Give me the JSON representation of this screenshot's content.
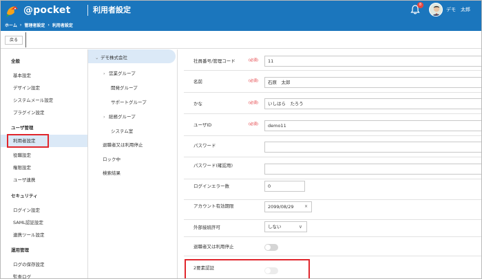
{
  "header": {
    "logo_text": "@pocket",
    "page_title": "利用者設定",
    "notification_count": "8",
    "user_name": "デモ　太郎",
    "breadcrumb": [
      "ホーム",
      "管理者設定",
      "利用者設定"
    ],
    "breadcrumb_separator": "›"
  },
  "toolbar": {
    "back_label": "戻る"
  },
  "leftnav": {
    "sections": [
      {
        "title": "全般",
        "items": [
          "基本設定",
          "デザイン設定",
          "システムメール設定",
          "プラグイン設定"
        ]
      },
      {
        "title": "ユーザ管理",
        "items": [
          "利用者設定",
          "役職設定",
          "権限設定",
          "ユーザ連携"
        ]
      },
      {
        "title": "セキュリティ",
        "items": [
          "ログイン設定",
          "SAML認証設定",
          "連携ツール設定"
        ]
      },
      {
        "title": "運用管理",
        "items": [
          "ログの保存設定",
          "監査ログ"
        ]
      }
    ],
    "active_item": "利用者設定"
  },
  "tree": {
    "root": "デモ株式会社",
    "children": [
      "営業グループ",
      "開発グループ",
      "サポートグループ",
      "総務グループ",
      "システム室"
    ],
    "extra": [
      "退職者又は利用停止",
      "ロック中",
      "検索結果"
    ]
  },
  "form": {
    "required_tag": "(必須)",
    "fields": [
      {
        "label": "社員番号/管理コード",
        "value": "11"
      },
      {
        "label": "名前",
        "value": "石原　太郎"
      },
      {
        "label": "かな",
        "value": "いしはら　たろう"
      },
      {
        "label": "ユーザID",
        "value": "demo11"
      },
      {
        "label": "パスワード",
        "value": ""
      },
      {
        "label": "パスワード(確認用)",
        "value": ""
      },
      {
        "label": "ログインエラー数",
        "value": "0"
      },
      {
        "label": "アカウント有効期限",
        "value": "2099/08/29",
        "clear": "×"
      },
      {
        "label": "外部接続許可",
        "value": "しない",
        "chevron": "∨"
      },
      {
        "label": "退職者又は利用停止",
        "toggle": false
      },
      {
        "label": "2要素認証",
        "toggle": false
      }
    ]
  },
  "colors": {
    "header_bg": "#1b76bd",
    "active_bg": "#dbe9f7",
    "highlight": "#e0252b",
    "badge": "#e8473e"
  }
}
